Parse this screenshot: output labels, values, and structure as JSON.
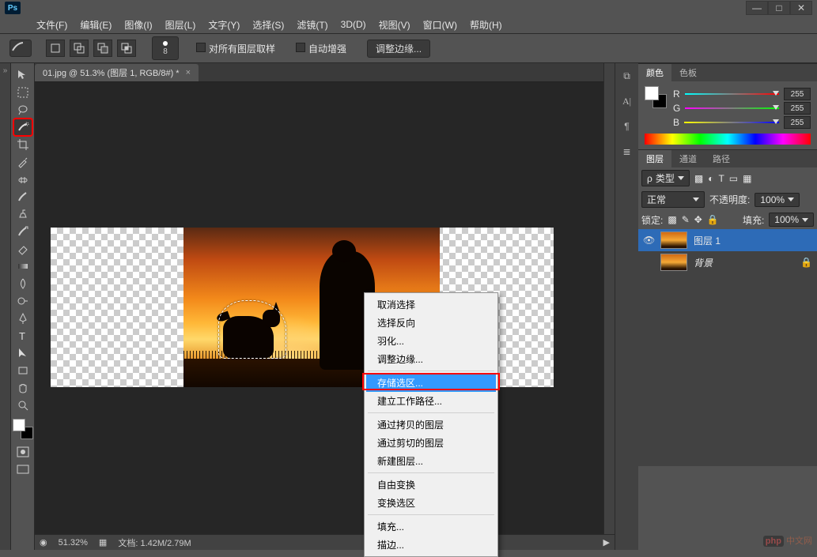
{
  "app": {
    "logo": "Ps"
  },
  "window_controls": {
    "min": "—",
    "max": "□",
    "close": "✕"
  },
  "menus": [
    "文件(F)",
    "编辑(E)",
    "图像(I)",
    "图层(L)",
    "文字(Y)",
    "选择(S)",
    "滤镜(T)",
    "3D(D)",
    "视图(V)",
    "窗口(W)",
    "帮助(H)"
  ],
  "options_bar": {
    "brush_size": "8",
    "sample_all": "对所有图层取样",
    "auto_enhance": "自动增强",
    "refine_edge": "调整边缘..."
  },
  "document": {
    "tab_title": "01.jpg @ 51.3% (图层 1, RGB/8#) *",
    "tab_close": "×"
  },
  "context_menu": {
    "items": [
      {
        "label": "取消选择",
        "enabled": true
      },
      {
        "label": "选择反向",
        "enabled": true
      },
      {
        "label": "羽化...",
        "enabled": true
      },
      {
        "label": "调整边缘...",
        "enabled": true
      },
      {
        "sep": true
      },
      {
        "label": "存储选区...",
        "enabled": true,
        "highlight": true
      },
      {
        "label": "建立工作路径...",
        "enabled": true
      },
      {
        "sep": true
      },
      {
        "label": "通过拷贝的图层",
        "enabled": true
      },
      {
        "label": "通过剪切的图层",
        "enabled": true
      },
      {
        "label": "新建图层...",
        "enabled": true
      },
      {
        "sep": true
      },
      {
        "label": "自由变换",
        "enabled": true
      },
      {
        "label": "变换选区",
        "enabled": true
      },
      {
        "sep": true
      },
      {
        "label": "填充...",
        "enabled": true
      },
      {
        "label": "描边...",
        "enabled": true
      }
    ]
  },
  "panels": {
    "color_tab": "颜色",
    "swatches_tab": "色板",
    "r_label": "R",
    "g_label": "G",
    "b_label": "B",
    "r_val": "255",
    "g_val": "255",
    "b_val": "255",
    "layers_tab": "图层",
    "channels_tab": "通道",
    "paths_tab": "路径",
    "kind_label": "类型",
    "blend_mode": "正常",
    "opacity_label": "不透明度:",
    "opacity_val": "100%",
    "lock_label": "锁定:",
    "fill_label": "填充:",
    "fill_val": "100%",
    "layer1": "图层 1",
    "bg_layer": "背景"
  },
  "status": {
    "zoom": "51.32%",
    "doc_label": "文档:",
    "doc_size": "1.42M/2.79M"
  },
  "watermark": "php中文网"
}
